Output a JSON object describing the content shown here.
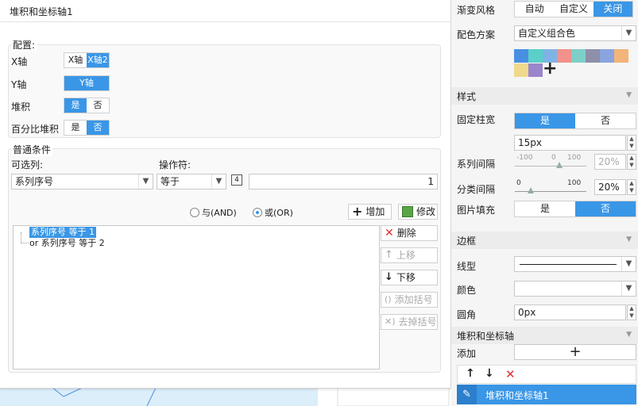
{
  "title": "堆积和坐标轴1",
  "config": {
    "legend": "配置:",
    "xaxis_label": "X轴",
    "xaxis_options": [
      "X轴",
      "X轴2"
    ],
    "yaxis_label": "Y轴",
    "yaxis_option": "Y轴",
    "stack_label": "堆积",
    "percent_stack_label": "百分比堆积",
    "yes": "是",
    "no": "否"
  },
  "condition": {
    "legend": "普通条件",
    "column_label": "可选列:",
    "column_value": "系列序号",
    "operator_label": "操作符:",
    "operator_value": "等于",
    "formula_badge": "4",
    "value": "1",
    "and_label": "与(AND)",
    "or_label": "或(OR)",
    "add_label": "增加",
    "modify_label": "修改",
    "rows": [
      "系列序号 等于 1",
      "or  系列序号 等于 2"
    ],
    "delete_label": "删除",
    "up_label": "上移",
    "down_label": "下移",
    "add_bracket_label": "添加括号",
    "remove_bracket_label": "去掉括号"
  },
  "right": {
    "gradient_label": "渐变风格",
    "gradient_options": [
      "自动",
      "自定义",
      "关闭"
    ],
    "scheme_label": "配色方案",
    "scheme_value": "自定义组合色",
    "swatches": [
      "#4a90e2",
      "#5ad0c8",
      "#7fb3e6",
      "#f2928a",
      "#7ecfc9",
      "#8e8fa8",
      "#8aa4e0",
      "#f2b478",
      "#f0d98a",
      "#9a86cc"
    ],
    "style_section": "样式",
    "fixed_width_label": "固定柱宽",
    "yes": "是",
    "no": "否",
    "width_value": "15px",
    "series_gap_label": "系列间隔",
    "series_gap_ticks": [
      "-100",
      "0",
      "100"
    ],
    "series_gap_value": "20%",
    "category_gap_label": "分类间隔",
    "category_gap_ticks": [
      "0",
      "100"
    ],
    "category_gap_value": "20%",
    "image_fill_label": "图片填充",
    "border_section": "边框",
    "line_type_label": "线型",
    "color_label": "颜色",
    "radius_label": "圆角",
    "radius_value": "0px",
    "stack_section": "堆积和坐标轴",
    "add_label": "添加",
    "list_item": "堆积和坐标轴1"
  }
}
